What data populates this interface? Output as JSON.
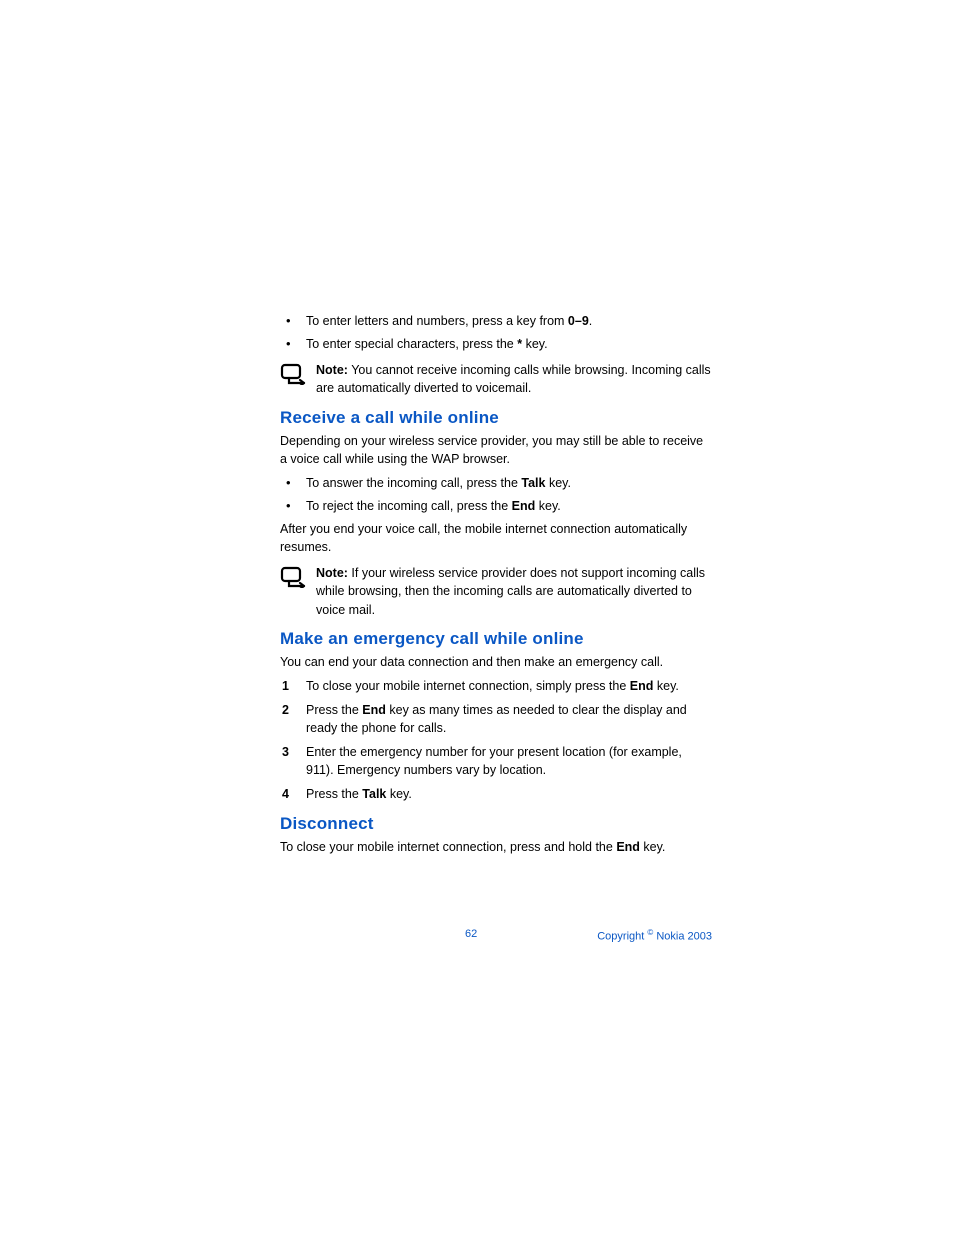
{
  "bullets_intro": [
    {
      "pre": "To enter letters and numbers, press a key from ",
      "bold": "0–9",
      "post": "."
    },
    {
      "pre": "To enter special characters, press the ",
      "bold": "*",
      "post": " key."
    }
  ],
  "note1": {
    "label": "Note:",
    "text": " You cannot receive incoming calls while browsing. Incoming calls are automatically diverted to voicemail."
  },
  "section_receive": {
    "heading": "Receive a call while online",
    "intro": "Depending on your wireless service provider, you may still be able to receive a voice call while using the WAP browser.",
    "bullets": [
      {
        "pre": "To answer the incoming call, press the ",
        "bold": "Talk",
        "post": " key."
      },
      {
        "pre": "To reject the incoming call, press the ",
        "bold": "End",
        "post": " key."
      }
    ],
    "after": "After you end your voice call, the mobile internet connection automatically resumes."
  },
  "note2": {
    "label": "Note:",
    "text": " If your wireless service provider does not support incoming calls while browsing, then the incoming calls are automatically diverted to voice mail."
  },
  "section_emergency": {
    "heading": "Make an emergency call while online",
    "intro": "You can end your data connection and then make an emergency call.",
    "steps": [
      {
        "pre": "To close your mobile internet connection, simply press the ",
        "bold": "End",
        "post": " key."
      },
      {
        "pre": "Press the ",
        "bold": "End",
        "post": " key as many times as needed to clear the display and ready the phone for calls."
      },
      {
        "pre": "Enter the emergency number for your present location (for example, 911). Emergency numbers vary by location.",
        "bold": "",
        "post": ""
      },
      {
        "pre": "Press the ",
        "bold": "Talk",
        "post": " key."
      }
    ]
  },
  "section_disconnect": {
    "heading": "Disconnect",
    "text_pre": "To close your mobile internet connection, press and hold the ",
    "text_bold": "End",
    "text_post": " key."
  },
  "footer": {
    "page": "62",
    "copyright_pre": "Copyright ",
    "copyright_sym": "©",
    "copyright_post": " Nokia 2003"
  }
}
